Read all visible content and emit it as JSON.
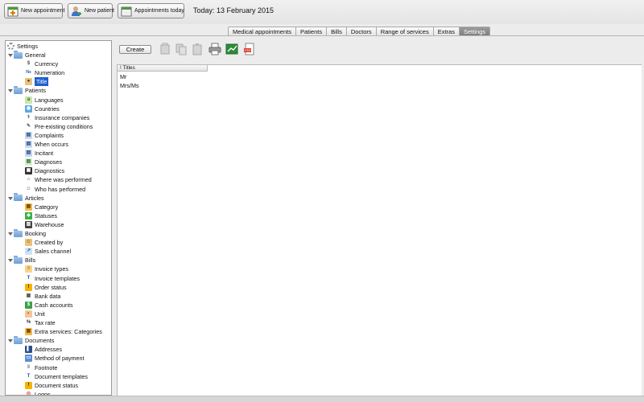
{
  "toolbar": {
    "new_appointment": "New appointment",
    "new_patient": "New patient",
    "appointments_today": "Appointments today",
    "today_text": "Today: 13 February 2015"
  },
  "tabs": [
    {
      "label": "Medical appointments",
      "active": false
    },
    {
      "label": "Patients",
      "active": false
    },
    {
      "label": "Bills",
      "active": false
    },
    {
      "label": "Doctors",
      "active": false
    },
    {
      "label": "Range of services",
      "active": false
    },
    {
      "label": "Extras",
      "active": false
    },
    {
      "label": "Settings",
      "active": true
    }
  ],
  "tree": {
    "root": "Settings",
    "groups": [
      {
        "label": "General",
        "items": [
          {
            "label": "Currency",
            "icon": "currency-icon"
          },
          {
            "label": "Numeration",
            "icon": "numeration-icon"
          },
          {
            "label": "Title",
            "icon": "person-icon",
            "selected": true
          }
        ]
      },
      {
        "label": "Patients",
        "items": [
          {
            "label": "Languages",
            "icon": "languages-icon"
          },
          {
            "label": "Countries",
            "icon": "globe-icon"
          },
          {
            "label": "Insurance companies",
            "icon": "caduceus-icon"
          },
          {
            "label": "Pre-existing conditions",
            "icon": "pencil-icon"
          },
          {
            "label": "Complaints",
            "icon": "clipboard-icon"
          },
          {
            "label": "When occurs",
            "icon": "clipboard-icon"
          },
          {
            "label": "Incitant",
            "icon": "clipboard-icon"
          },
          {
            "label": "Diagnoses",
            "icon": "document-icon"
          },
          {
            "label": "Diagnostics",
            "icon": "monitor-icon"
          },
          {
            "label": "Where was performed",
            "icon": "building-icon"
          },
          {
            "label": "Who has performed",
            "icon": "doctor-icon"
          }
        ]
      },
      {
        "label": "Articles",
        "items": [
          {
            "label": "Category",
            "icon": "category-icon"
          },
          {
            "label": "Statuses",
            "icon": "diamond-icon"
          },
          {
            "label": "Warehouse",
            "icon": "warehouse-icon"
          }
        ]
      },
      {
        "label": "Booking",
        "items": [
          {
            "label": "Created by",
            "icon": "users-icon"
          },
          {
            "label": "Sales channel",
            "icon": "chart-icon"
          }
        ]
      },
      {
        "label": "Bills",
        "items": [
          {
            "label": "Invoice types",
            "icon": "invoice-icon"
          },
          {
            "label": "Invoice templates",
            "icon": "template-icon"
          },
          {
            "label": "Order status",
            "icon": "warning-icon"
          },
          {
            "label": "Bank data",
            "icon": "bank-icon"
          },
          {
            "label": "Cash accounts",
            "icon": "cash-icon"
          },
          {
            "label": "Unit",
            "icon": "unit-icon"
          },
          {
            "label": "Tax rate",
            "icon": "percent-icon"
          },
          {
            "label": "Extra services: Categories",
            "icon": "category-icon"
          }
        ]
      },
      {
        "label": "Documents",
        "items": [
          {
            "label": "Addresses",
            "icon": "book-icon"
          },
          {
            "label": "Method of payment",
            "icon": "payment-icon"
          },
          {
            "label": "Footnote",
            "icon": "footnote-icon"
          },
          {
            "label": "Document templates",
            "icon": "template-icon"
          },
          {
            "label": "Document status",
            "icon": "warning-icon"
          },
          {
            "label": "Logos",
            "icon": "logo-icon"
          }
        ]
      }
    ]
  },
  "main": {
    "create_label": "Create",
    "column_header": "! Titles",
    "rows": [
      "Mr",
      "Mrs/Ms"
    ]
  },
  "colors": {
    "selection": "#1f5fcf",
    "active_tab": "#8a8a8a",
    "folder": "#6b9fd6"
  }
}
